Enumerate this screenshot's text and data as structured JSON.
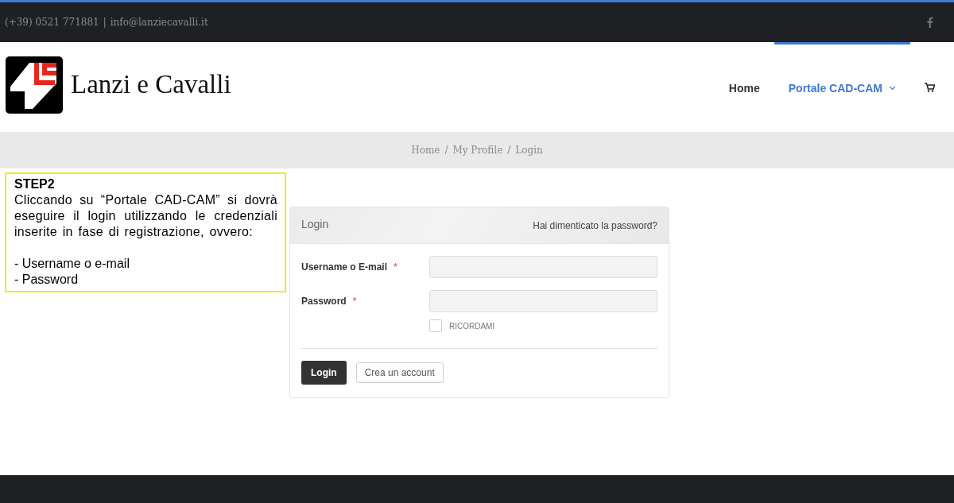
{
  "top_bar": {
    "phone": "(+39) 0521 771881",
    "separator": "|",
    "email": "info@lanziecavalli.it"
  },
  "header": {
    "brand": "Lanzi e Cavalli",
    "nav": [
      {
        "label": "Home",
        "selected": false,
        "dropdown": false
      },
      {
        "label": "Portale CAD-CAM",
        "selected": true,
        "dropdown": true
      }
    ]
  },
  "breadcrumb": {
    "separator": "/",
    "items": [
      "Home",
      "My Profile",
      "Login"
    ]
  },
  "note": {
    "title": "STEP2",
    "text": "Cliccando su “Portale CAD-CAM” si dovrà eseguire il login utilizzando le credenziali inserite in fase di registrazione, ovvero:",
    "items": [
      "- Username o e-mail",
      "- Password"
    ]
  },
  "login": {
    "title": "Login",
    "forgot_link": "Hai dimenticato la password?",
    "fields": [
      {
        "label": "Username o E-mail",
        "required": "*"
      },
      {
        "label": "Password",
        "required": "*"
      }
    ],
    "remember": {
      "label": "RICORDAMI",
      "checked": false
    },
    "buttons": [
      {
        "label": "Login",
        "kind": "primary"
      },
      {
        "label": "Crea un account",
        "kind": "secondary"
      }
    ]
  }
}
